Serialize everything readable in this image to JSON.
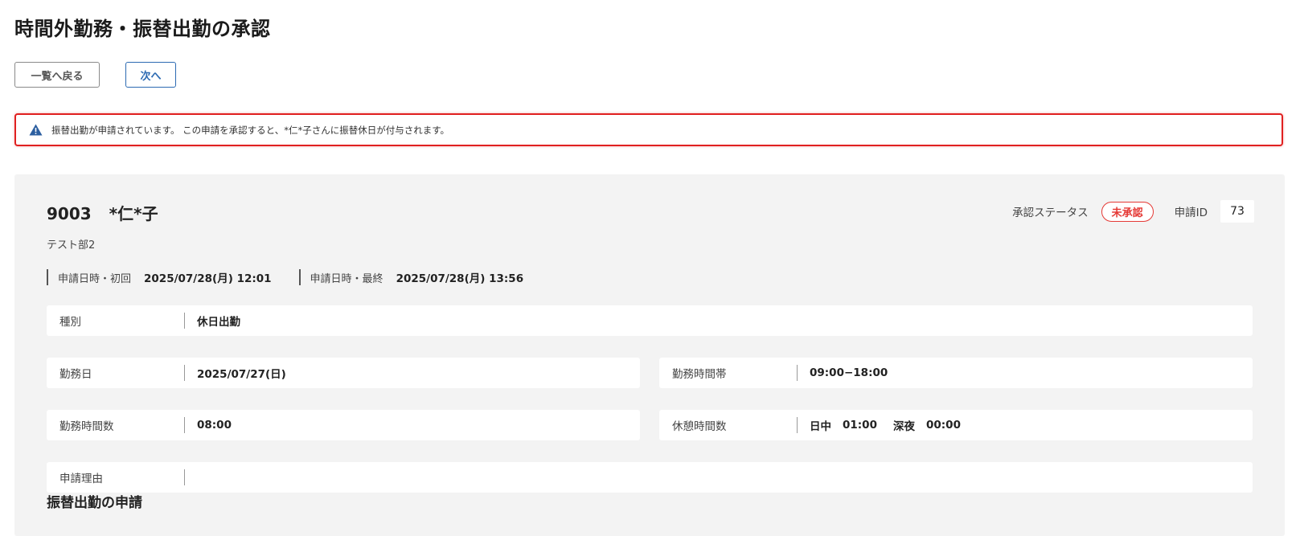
{
  "page": {
    "title": "時間外勤務・振替出勤の承認"
  },
  "nav": {
    "back_label": "一覧へ戻る",
    "next_label": "次へ"
  },
  "alert": {
    "text": "振替出勤が申請されています。 この申請を承認すると、*仁*子さんに振替休日が付与されます。",
    "icon": "warning-icon",
    "border_color": "#e02020"
  },
  "employee": {
    "id": "9003",
    "name": "*仁*子",
    "department": "テスト部2"
  },
  "status": {
    "label": "承認ステータス",
    "value": "未承認",
    "color": "#e53935",
    "request_id_label": "申請ID",
    "request_id": "73"
  },
  "dates": {
    "first_label": "申請日時・初回",
    "first_value": "2025/07/28(月) 12:01",
    "last_label": "申請日時・最終",
    "last_value": "2025/07/28(月) 13:56"
  },
  "details": {
    "type": {
      "label": "種別",
      "value": "休日出勤"
    },
    "work_date": {
      "label": "勤務日",
      "value": "2025/07/27(日)"
    },
    "work_hours_range": {
      "label": "勤務時間帯",
      "value": "09:00−18:00"
    },
    "work_hours": {
      "label": "勤務時間数",
      "value": "08:00"
    },
    "break_hours": {
      "label": "休憩時間数",
      "day_label": "日中",
      "day_value": "01:00",
      "night_label": "深夜",
      "night_value": "00:00"
    },
    "reason": {
      "label": "申請理由",
      "value": ""
    }
  },
  "sections": {
    "substitute_title": "振替出勤の申請"
  },
  "colors": {
    "accent": "#2c6ab2",
    "panel_bg": "#f3f3f3",
    "alert_icon": "#2c5fa0"
  }
}
